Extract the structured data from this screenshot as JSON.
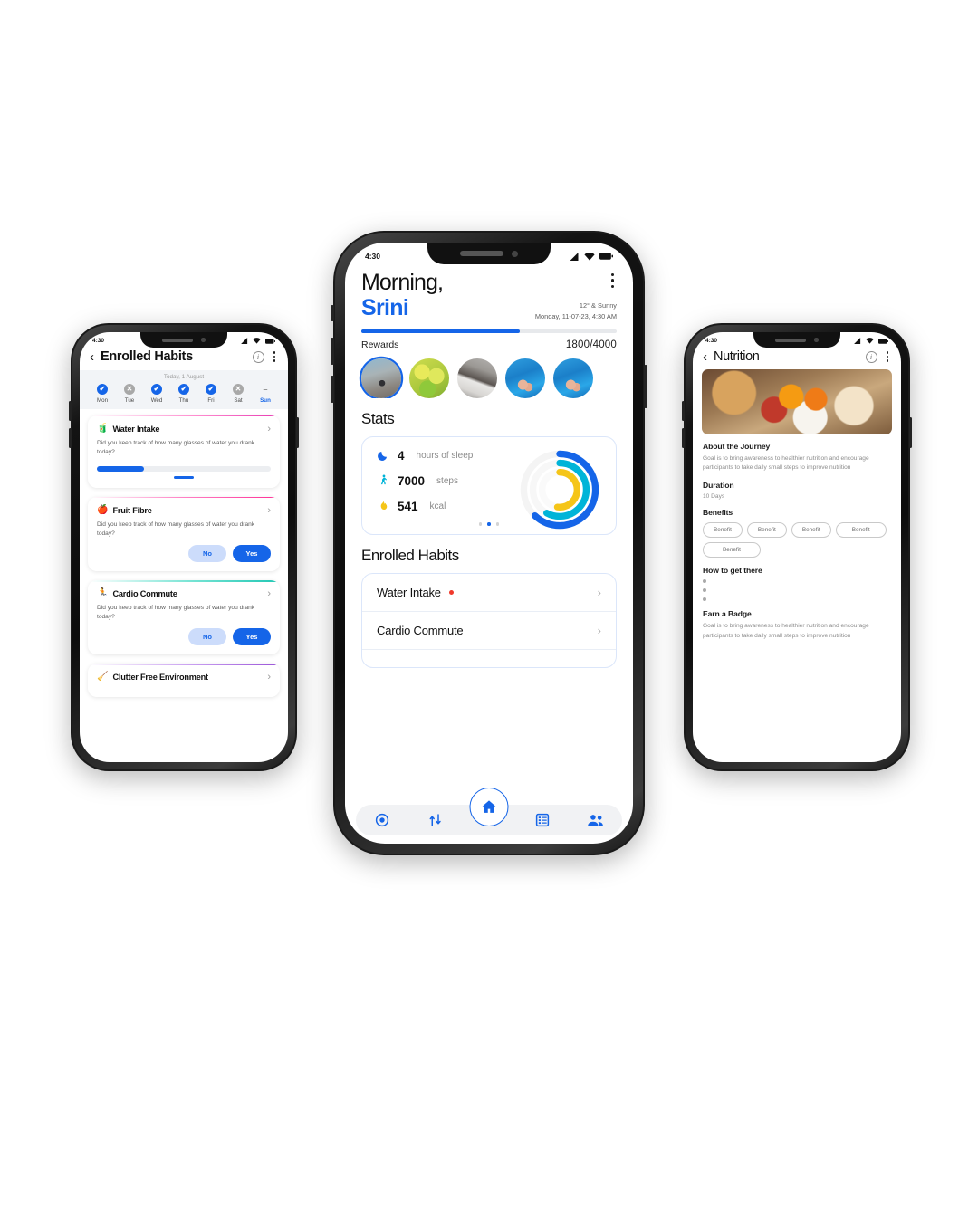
{
  "theme": {
    "accent": "#1565E8",
    "accent_light": "#ccdcfb",
    "ring_outer": "#1565E8",
    "ring_mid": "#00B4D8",
    "ring_inner": "#F5C518",
    "alert_dot": "#F0392B",
    "muted_text": "#8C8C8C"
  },
  "left_phone": {
    "status_bar": {
      "time": "4:30",
      "signal_icon": "signal-icon",
      "wifi_icon": "wifi-icon",
      "battery_icon": "battery-icon"
    },
    "appbar": {
      "back_icon": "chevron-left-icon",
      "title": "Enrolled Habits",
      "info_icon": "info-icon",
      "menu_icon": "kebab-menu-icon"
    },
    "daystrip": {
      "today_label": "Today, 1 August",
      "days": [
        {
          "name": "Mon",
          "state": "done",
          "glyph": "✔"
        },
        {
          "name": "Tue",
          "state": "missed",
          "glyph": "✕"
        },
        {
          "name": "Wed",
          "state": "done",
          "glyph": "✔"
        },
        {
          "name": "Thu",
          "state": "done",
          "glyph": "✔"
        },
        {
          "name": "Fri",
          "state": "done",
          "glyph": "✔"
        },
        {
          "name": "Sat",
          "state": "missed",
          "glyph": "✕"
        },
        {
          "name": "Sun",
          "state": "none",
          "glyph": "–"
        }
      ]
    },
    "habits": [
      {
        "emoji": "🧃",
        "icon_name": "juice-box-icon",
        "name": "Water Intake",
        "question": "Did you keep track of how many glasses of water you drank today?",
        "control": "slider",
        "progress_percent": 27,
        "chevron": "›",
        "accent_stripe": "pink"
      },
      {
        "emoji": "🍎",
        "icon_name": "apple-icon",
        "name": "Fruit Fibre",
        "question": "Did you keep track of how many glasses of water you drank today?",
        "control": "yes_no",
        "no_label": "No",
        "yes_label": "Yes",
        "chevron": "›",
        "accent_stripe": "pink"
      },
      {
        "emoji": "🏃",
        "icon_name": "runner-icon",
        "name": "Cardio Commute",
        "question": "Did you keep track of how many glasses of water you drank today?",
        "control": "yes_no",
        "no_label": "No",
        "yes_label": "Yes",
        "chevron": "›",
        "accent_stripe": "teal"
      },
      {
        "emoji": "🧹",
        "icon_name": "broom-icon",
        "name": "Clutter Free Environment",
        "question": "",
        "control": "none",
        "chevron": "›",
        "accent_stripe": "violet"
      }
    ]
  },
  "center_phone": {
    "status_bar": {
      "time": "4:30",
      "signal_icon": "signal-icon",
      "wifi_icon": "wifi-icon",
      "battery_icon": "battery-icon"
    },
    "header": {
      "greeting": "Morning,",
      "user_name": "Srini",
      "menu_icon": "kebab-menu-icon",
      "weather": "12° & Sunny",
      "datetime": "Monday, 11-07-23, 4:30 AM"
    },
    "rewards": {
      "label": "Rewards",
      "value": "1800/4000",
      "progress_percent": 62,
      "avatars": [
        {
          "name": "reward-avatar-running",
          "selected": true,
          "art": "ph-run"
        },
        {
          "name": "reward-avatar-lemons",
          "selected": false,
          "art": "ph-lemon"
        },
        {
          "name": "reward-avatar-gym",
          "selected": false,
          "art": "ph-gym"
        },
        {
          "name": "reward-avatar-pool-1",
          "selected": false,
          "art": "ph-pool"
        },
        {
          "name": "reward-avatar-pool-2",
          "selected": false,
          "art": "ph-pool"
        }
      ]
    },
    "stats": {
      "section_title": "Stats",
      "items": [
        {
          "icon": "moon-icon",
          "glyph": "🌙",
          "value": "4",
          "unit": "hours of sleep"
        },
        {
          "icon": "walking-icon",
          "glyph": "🚶",
          "value": "7000",
          "unit": "steps"
        },
        {
          "icon": "flame-icon",
          "glyph": "🔥",
          "value": "541",
          "unit": "kcal"
        }
      ],
      "carousel_dots": 3,
      "carousel_active_index": 1,
      "rings": [
        {
          "name": "outer-ring-steps",
          "color": "#1565E8",
          "percent": 62
        },
        {
          "name": "mid-ring-calories",
          "color": "#00B4D8",
          "percent": 58
        },
        {
          "name": "inner-ring-sleep",
          "color": "#F5C518",
          "percent": 52
        }
      ]
    },
    "enrolled_habits": {
      "section_title": "Enrolled Habits",
      "rows": [
        {
          "label": "Water Intake",
          "has_alert_dot": true,
          "chevron": "›"
        },
        {
          "label": "Cardio Commute",
          "has_alert_dot": false,
          "chevron": "›"
        }
      ]
    },
    "bottom_nav": [
      {
        "name": "nav-target-icon",
        "glyph": "target"
      },
      {
        "name": "nav-journey-icon",
        "glyph": "journey"
      },
      {
        "name": "nav-home-icon",
        "glyph": "home",
        "active": true
      },
      {
        "name": "nav-list-icon",
        "glyph": "list"
      },
      {
        "name": "nav-community-icon",
        "glyph": "people"
      }
    ]
  },
  "right_phone": {
    "status_bar": {
      "time": "4:30",
      "signal_icon": "signal-icon",
      "wifi_icon": "wifi-icon",
      "battery_icon": "battery-icon"
    },
    "appbar": {
      "back_icon": "chevron-left-icon",
      "title": "Nutrition",
      "info_icon": "info-icon",
      "menu_icon": "kebab-menu-icon"
    },
    "hero_image_name": "nutrition-breakfast-photo",
    "sections": {
      "about_title": "About the Journey",
      "about_body": "Goal is to bring awareness to healthier nutrition and encourage participants to take daily small steps to improve nutrition",
      "duration_title": "Duration",
      "duration_value": "10 Days",
      "benefits_title": "Benefits",
      "benefits": [
        "Benefit",
        "Benefit",
        "Benefit",
        "Benefit",
        "Benefit"
      ],
      "how_title": "How to get there",
      "how_bullets": 3,
      "badge_title": "Earn a Badge",
      "badge_body": "Goal is to bring awareness to healthier nutrition and encourage participants to take daily small steps to improve nutrition"
    }
  }
}
